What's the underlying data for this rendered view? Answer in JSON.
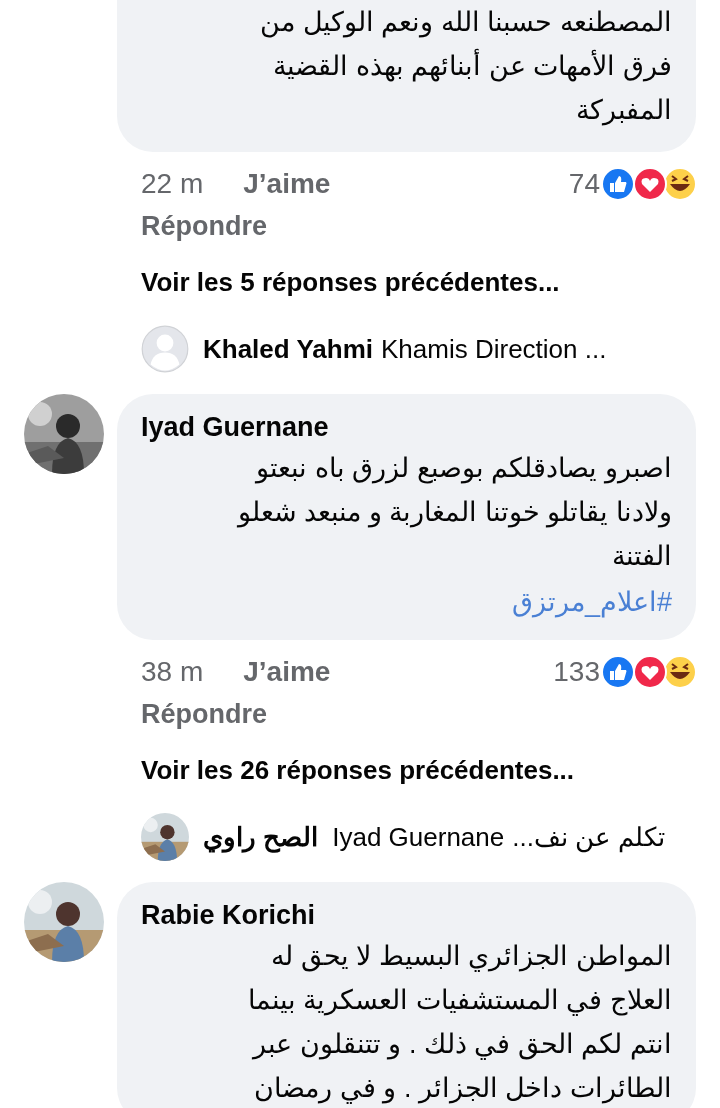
{
  "comments": [
    {
      "kind": "continued",
      "text_lines": [
        "المصطنعه حسبنا الله ونعم الوكيل من",
        "فرق الأمهات عن أبنائهم بهذه القضية",
        "المفبركة"
      ],
      "time": "22 m",
      "like": "J’aime",
      "reply": "Répondre",
      "reaction_count": "74",
      "more_replies": "Voir les 5 réponses précédentes...",
      "preview": {
        "avatar": {
          "kind": "silhouette"
        },
        "name": "Khaled Yahmi",
        "snippet": "Khamis Direction ..."
      }
    },
    {
      "kind": "full",
      "avatar": {
        "kind": "picture"
      },
      "author": "Iyad Guernane",
      "text_lines": [
        "اصبرو يصادقلكم بوصبع لزرق باه نبعتو",
        "ولادنا يقاتلو خوتنا المغاربة و منبعد شعلو",
        "الفتنة"
      ],
      "hashtag": "#اعلام_مرتزق",
      "time": "38 m",
      "like": "J’aime",
      "reply": "Répondre",
      "reaction_count": "133",
      "more_replies": "Voir les 26 réponses précédentes...",
      "preview": {
        "avatar": {
          "kind": "picture"
        },
        "name": "الصح راوي",
        "mention": "Iyad Guernane",
        "snippet": "تكلم عن نف..."
      }
    },
    {
      "kind": "full",
      "avatar": {
        "kind": "picture"
      },
      "author": "Rabie Korichi",
      "text_lines": [
        "المواطن الجزائري البسيط لا يحق له",
        "العلاج في المستشفيات العسكرية بينما",
        "انتم لكم الحق في ذلك . و تتنقلون عبر",
        "الطائرات داخل الجزائر . و في رمضان"
      ]
    }
  ]
}
